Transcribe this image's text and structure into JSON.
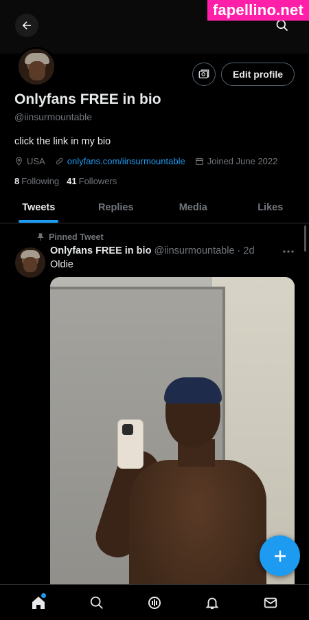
{
  "watermark": "fapellino.net",
  "profile": {
    "display_name": "Onlyfans FREE in bio",
    "handle": "@iinsurmountable",
    "bio": "click the link in my bio",
    "location": "USA",
    "link": "onlyfans.com/iinsurmountable",
    "joined": "Joined June 2022",
    "following_count": "8",
    "following_label": "Following",
    "followers_count": "41",
    "followers_label": "Followers",
    "edit_label": "Edit profile"
  },
  "tabs": [
    {
      "label": "Tweets",
      "active": true
    },
    {
      "label": "Replies",
      "active": false
    },
    {
      "label": "Media",
      "active": false
    },
    {
      "label": "Likes",
      "active": false
    }
  ],
  "tweet": {
    "pinned_label": "Pinned Tweet",
    "name": "Onlyfans FREE in bio",
    "handle_time": "@iinsurmountable · 2d",
    "text": "Oldie"
  },
  "colors": {
    "accent": "#1d9bf0",
    "background": "#000000",
    "text": "#e7e9ea",
    "secondary": "#71767b",
    "watermark_bg": "#ff1fa8"
  },
  "icons": {
    "back": "arrow-left-icon",
    "search": "search-icon",
    "location": "location-pin-icon",
    "link": "link-icon",
    "calendar": "calendar-icon",
    "pin": "pin-icon",
    "more": "more-horizontal-icon",
    "compose": "plus-icon",
    "nav": [
      "home-icon",
      "search-icon",
      "spaces-icon",
      "notifications-icon",
      "messages-icon"
    ]
  }
}
